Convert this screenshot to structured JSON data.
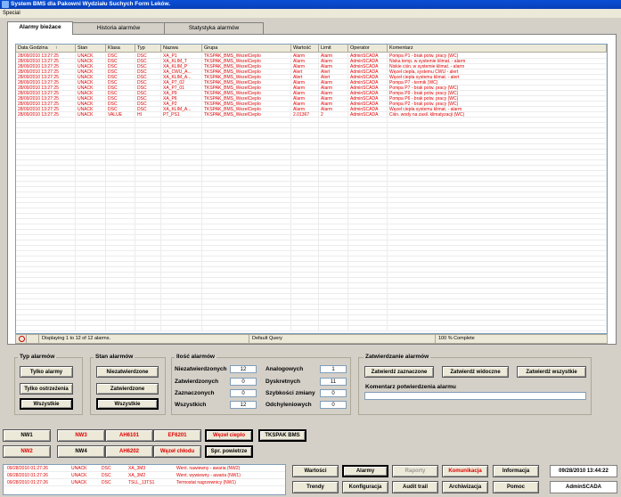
{
  "window": {
    "title": "System BMS dla Pakowni Wydziału Suchych Form Leków."
  },
  "menu": {
    "special": "Special"
  },
  "tabs": [
    "Alarmy bieżace",
    "Historia alarmów",
    "Statystyka alarmów"
  ],
  "grid": {
    "columns": [
      "Data Godzina",
      "Stan",
      "Klasa",
      "Typ",
      "Nazwa",
      "Grupa",
      "Wartość",
      "Limit",
      "Operator",
      "Komentarz"
    ],
    "sort_marker": "↑",
    "rows": [
      [
        "28/09/2010 13:27:25",
        "UNACK",
        "DSC",
        "DSC",
        "XA_P1",
        "TKSPAK_BMS_WezelCieplo",
        "Alarm",
        "Alarm",
        "AdminSCADA",
        "Pompa P1 - brak potw. pracy (WC)"
      ],
      [
        "28/09/2010 13:27:25",
        "UNACK",
        "DSC",
        "DSC",
        "XA_KLIM_T",
        "TKSPAK_BMS_WezelCieplo",
        "Alarm",
        "Alarm",
        "AdminSCADA",
        "Niska temp. w systemie klimat. - alarm"
      ],
      [
        "28/09/2010 13:27:25",
        "UNACK",
        "DSC",
        "DSC",
        "XA_KLIM_P",
        "TKSPAK_BMS_WezelCieplo",
        "Alarm",
        "Alarm",
        "AdminSCADA",
        "Niskie ciśn. w systemie klimat. - alarm"
      ],
      [
        "28/09/2010 13:27:25",
        "UNACK",
        "DSC",
        "DSC",
        "XA_CWU_A...",
        "TKSPAK_BMS_WezelCieplo",
        "Alert",
        "Alert",
        "AdminSCADA",
        "Węzeł ciepła, systemu CWU - alert"
      ],
      [
        "28/09/2010 13:27:25",
        "UNACK",
        "DSC",
        "DSC",
        "XA_KLIM_A...",
        "TKSPAK_BMS_WezelCieplo",
        "Alert",
        "Alert",
        "AdminSCADA",
        "Węzeł ciepła systemu klimat. - alert"
      ],
      [
        "28/09/2010 13:27:25",
        "UNACK",
        "DSC",
        "DSC",
        "XA_P7_02",
        "TKSPAK_BMS_WezelCieplo",
        "Alarm",
        "Alarm",
        "AdminSCADA",
        "Pompa P7 - termik (WC)"
      ],
      [
        "28/09/2010 13:27:25",
        "UNACK",
        "DSC",
        "DSC",
        "XA_P7_01",
        "TKSPAK_BMS_WezelCieplo",
        "Alarm",
        "Alarm",
        "AdminSCADA",
        "Pompa P7 - brak potw. pracy (WC)"
      ],
      [
        "28/09/2010 13:27:25",
        "UNACK",
        "DSC",
        "DSC",
        "XA_P9",
        "TKSPAK_BMS_WezelCieplo",
        "Alarm",
        "Alarm",
        "AdminSCADA",
        "Pompa P9 - brak potw. pracy (WC)"
      ],
      [
        "28/09/2010 13:27:25",
        "UNACK",
        "DSC",
        "DSC",
        "XA_P6",
        "TKSPAK_BMS_WezelCieplo",
        "Alarm",
        "Alarm",
        "AdminSCADA",
        "Pompa P6 - brak potw. pracy (WC)"
      ],
      [
        "28/09/2010 13:27:25",
        "UNACK",
        "DSC",
        "DSC",
        "XA_P2",
        "TKSPAK_BMS_WezelCieplo",
        "Alarm",
        "Alarm",
        "AdminSCADA",
        "Pompa P2 - brak potw. pracy (WC)"
      ],
      [
        "28/09/2010 13:27:25",
        "UNACK",
        "DSC",
        "DSC",
        "XA_KLIM_A...",
        "TKSPAK_BMS_WezelCieplo",
        "Alarm",
        "Alarm",
        "AdminSCADA",
        "Węzeł ciepła systemu klimat. - alarm"
      ],
      [
        "28/09/2010 13:27:25",
        "UNACK",
        "VALUE",
        "HI",
        "PT_PS1",
        "TKSPAK_BMS_WezelCieplo",
        "2.01367",
        "2",
        "AdminSCADA",
        "Ciśn. wody na zasil. klimatyzacji (WC)"
      ]
    ]
  },
  "status": {
    "info": "Displaying 1 to 12 of 12 alarms.",
    "query": "Default Query",
    "progress": "100 % Complete"
  },
  "typ_alarmow": {
    "title": "Typ alarmów",
    "buttons": [
      "Tylko alarmy",
      "Tylko ostrzeżenia",
      "Wszystkie"
    ]
  },
  "stan_alarmow": {
    "title": "Stan alarmów",
    "buttons": [
      "Niezatwierdzone",
      "Zatwierdzone",
      "Wszystkie"
    ]
  },
  "ilosc": {
    "title": "Ilość alarmów",
    "left": [
      {
        "label": "Niezatwierdzonych",
        "value": "12"
      },
      {
        "label": "Zatwierdzonych",
        "value": "0"
      },
      {
        "label": "Zaznaczonych",
        "value": "0"
      },
      {
        "label": "Wszystkich",
        "value": "12"
      }
    ],
    "right": [
      {
        "label": "Analogowych",
        "value": "1"
      },
      {
        "label": "Dyskretnych",
        "value": "11"
      },
      {
        "label": "Szybkości zmiany",
        "value": "0"
      },
      {
        "label": "Odchyleniowych",
        "value": "0"
      }
    ]
  },
  "zatwierdzanie": {
    "title": "Zatwierdzanie alarmów",
    "buttons": [
      "Zatwierdź zaznaczone",
      "Zatwierdź widoczne",
      "Zatwierdź wszystkie"
    ],
    "comment_label": "Komentarz potwierdzenia alarmu"
  },
  "nav_row1": [
    "NW1",
    "NW3",
    "AH6101",
    "EF6201",
    "Węzeł cieplo",
    "TKSPAK BMS"
  ],
  "nav_row2": [
    "NW2",
    "NW4",
    "AH6202",
    "Węzeł chłodu",
    "Spr. powietrze"
  ],
  "bottom_alarms": [
    [
      "09/28/2010 01:27:26",
      "UNACK",
      "DSC",
      "XA_3M3",
      "Went. nawiewny - awaria (NW2)"
    ],
    [
      "09/28/2010 01:27:26",
      "UNACK",
      "DSC",
      "XA_3M2",
      "Went. wywiewny - awaria (NW1)"
    ],
    [
      "09/28/2010 01:27:26",
      "UNACK",
      "DSC",
      "TSLL_13TS1",
      "Termostat nagrzewnicy (NW1)"
    ]
  ],
  "main_buttons_row1": [
    "Wartości",
    "Alarmy",
    "Raporty",
    "Komunikacja",
    "Informacja"
  ],
  "main_buttons_row2": [
    "Trendy",
    "Konfiguracja",
    "Audit trail",
    "Archiwizacja",
    "Pomoc"
  ],
  "clock": "09/28/2010 13:44:22",
  "user": "AdminSCADA",
  "colors": {
    "alarm_red": "#e00000",
    "title_blue": "#0a4fd6",
    "face": "#d4d0c8"
  }
}
